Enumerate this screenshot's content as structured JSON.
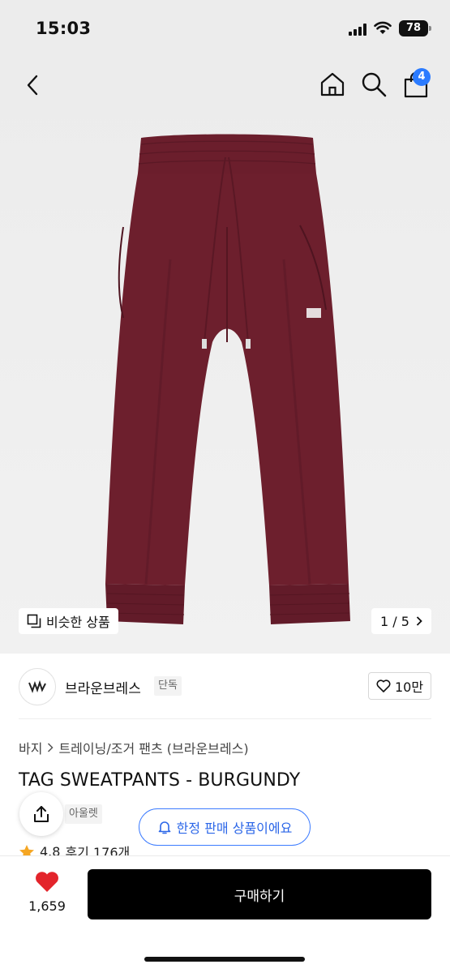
{
  "status_bar": {
    "time": "15:03",
    "battery": "78"
  },
  "header": {
    "cart_count": "4"
  },
  "gallery": {
    "similar_label": "비슷한 상품",
    "page_indicator": "1 / 5"
  },
  "brand": {
    "name": "브라운브레스",
    "tag": "단독",
    "likes": "10만"
  },
  "product": {
    "breadcrumb": [
      "바지",
      "트레이닝/조거 팬츠 (브라운브레스)"
    ],
    "title": "TAG SWEATPANTS - BURGUNDY",
    "outlet_tag": "아울렛",
    "limited_label": "한정 판매 상품이에요",
    "rating": "4.8",
    "reviews": "후기 176개"
  },
  "bottom_bar": {
    "heart_count": "1,659",
    "buy_label": "구매하기"
  },
  "colors": {
    "accent_blue": "#2b7bff",
    "heart_red": "#e3242b",
    "product_burgundy": "#6b1e2c"
  }
}
